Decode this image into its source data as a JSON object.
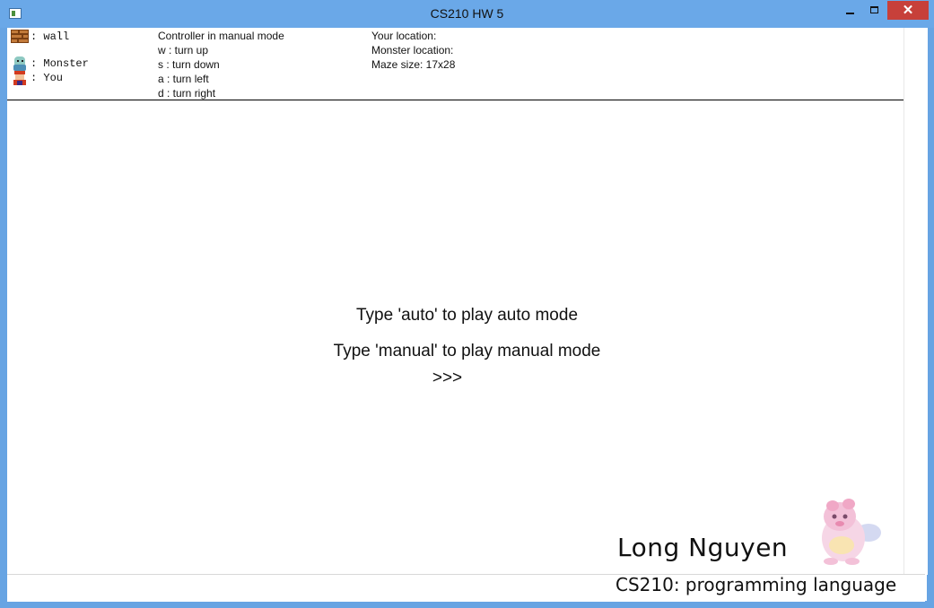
{
  "window": {
    "title": "CS210 HW 5",
    "close_glyph": "✕"
  },
  "legend": {
    "wall": ": wall",
    "monster": ": Monster",
    "you": ": You",
    "icons": [
      "brick-wall-icon",
      "monster-icon",
      "player-icon"
    ]
  },
  "controls": {
    "mode": "Controller in manual mode",
    "keys": [
      "w : turn up",
      "s : turn down",
      "a : turn left",
      "d : turn right"
    ]
  },
  "status": {
    "your_location": "Your location:",
    "monster_location": "Monster location:",
    "maze_size": "Maze size: 17x28"
  },
  "prompt": {
    "auto": "Type 'auto' to play auto mode",
    "manual": "Type 'manual' to play manual mode",
    "cursor": ">>>"
  },
  "signature": {
    "name": "Long Nguyen",
    "course": "CS210: programming language"
  },
  "colors": {
    "titlebar": "#6aa8e8",
    "close_button": "#c7403a",
    "background": "#ffffff"
  }
}
